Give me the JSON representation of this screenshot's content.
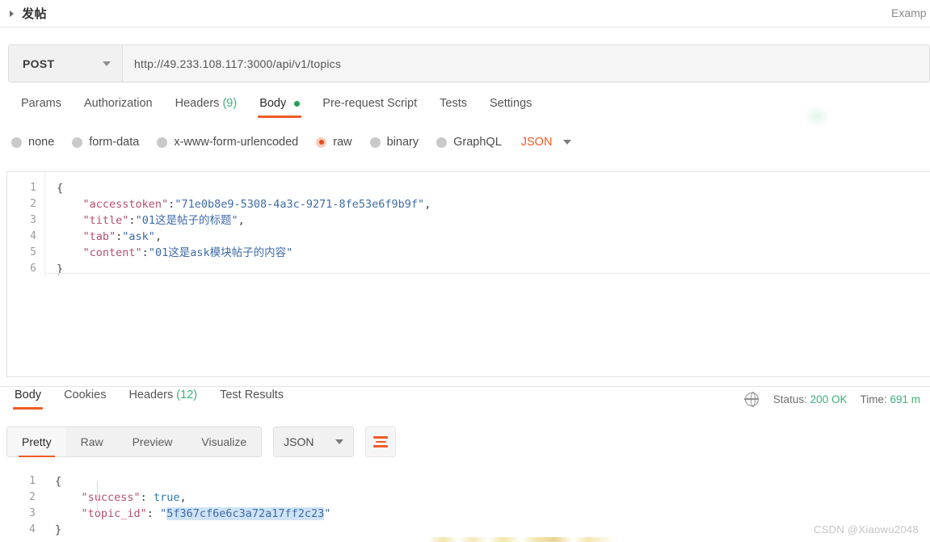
{
  "topbar": {
    "collapse_icon": "caret-right-icon",
    "title": "发帖",
    "right_label": "Examp"
  },
  "request": {
    "method": "POST",
    "method_caret": "chevron-down-icon",
    "url": "http://49.233.108.117:3000/api/v1/topics",
    "tabs": [
      {
        "label": "Params",
        "count": "",
        "active": false,
        "dot": false
      },
      {
        "label": "Authorization",
        "count": "",
        "active": false,
        "dot": false
      },
      {
        "label": "Headers",
        "count": "(9)",
        "active": false,
        "dot": false
      },
      {
        "label": "Body",
        "count": "",
        "active": true,
        "dot": true
      },
      {
        "label": "Pre-request Script",
        "count": "",
        "active": false,
        "dot": false
      },
      {
        "label": "Tests",
        "count": "",
        "active": false,
        "dot": false
      },
      {
        "label": "Settings",
        "count": "",
        "active": false,
        "dot": false
      }
    ],
    "body_types": [
      {
        "label": "none",
        "selected": false
      },
      {
        "label": "form-data",
        "selected": false
      },
      {
        "label": "x-www-form-urlencoded",
        "selected": false
      },
      {
        "label": "raw",
        "selected": true
      },
      {
        "label": "binary",
        "selected": false
      },
      {
        "label": "GraphQL",
        "selected": false
      }
    ],
    "format": "JSON",
    "format_caret": "chevron-down-icon",
    "body_lines": [
      {
        "num": "1",
        "open_brace": "{"
      },
      {
        "num": "2",
        "key": "\"accesstoken\"",
        "colon": ":",
        "value": "\"71e0b8e9-5308-4a3c-9271-8fe53e6f9b9f\"",
        "comma": ","
      },
      {
        "num": "3",
        "key": "\"title\"",
        "colon": ":",
        "value": "\"01这是帖子的标题\"",
        "comma": ","
      },
      {
        "num": "4",
        "key": "\"tab\"",
        "colon": ":",
        "value": "\"ask\"",
        "comma": ","
      },
      {
        "num": "5",
        "key": "\"content\"",
        "colon": ":",
        "value": "\"01这是ask模块帖子的内容\"",
        "comma": ""
      },
      {
        "num": "6",
        "close_brace": "}"
      }
    ]
  },
  "response": {
    "tabs": [
      {
        "label": "Body",
        "count": "",
        "active": true
      },
      {
        "label": "Cookies",
        "count": "",
        "active": false
      },
      {
        "label": "Headers",
        "count": "(12)",
        "active": false
      },
      {
        "label": "Test Results",
        "count": "",
        "active": false
      }
    ],
    "network_icon": "globe-icon",
    "status_label": "Status:",
    "status_value": "200 OK",
    "time_label": "Time:",
    "time_value": "691 m",
    "view_tabs": [
      {
        "label": "Pretty",
        "active": true
      },
      {
        "label": "Raw",
        "active": false
      },
      {
        "label": "Preview",
        "active": false
      },
      {
        "label": "Visualize",
        "active": false
      }
    ],
    "format": "JSON",
    "format_caret": "chevron-down-icon",
    "wrap_icon": "word-wrap-icon",
    "body_lines": [
      {
        "num": "1",
        "open_brace": "{"
      },
      {
        "num": "2",
        "key": "\"success\"",
        "colon": ":",
        "value": "true",
        "comma": ",",
        "kind": "bool"
      },
      {
        "num": "3",
        "key": "\"topic_id\"",
        "colon": ":",
        "value": "5f367cf6e6c3a72a17ff2c23",
        "comma": "",
        "kind": "string-highlighted"
      },
      {
        "num": "4",
        "close_brace": "}"
      }
    ]
  },
  "watermark": "CSDN @Xiaowu2048",
  "colors": {
    "accent": "#ef5b25",
    "success": "#3cb179",
    "selection": "#cfe3f5",
    "key": "#b5506b",
    "string": "#3f6ba8"
  }
}
